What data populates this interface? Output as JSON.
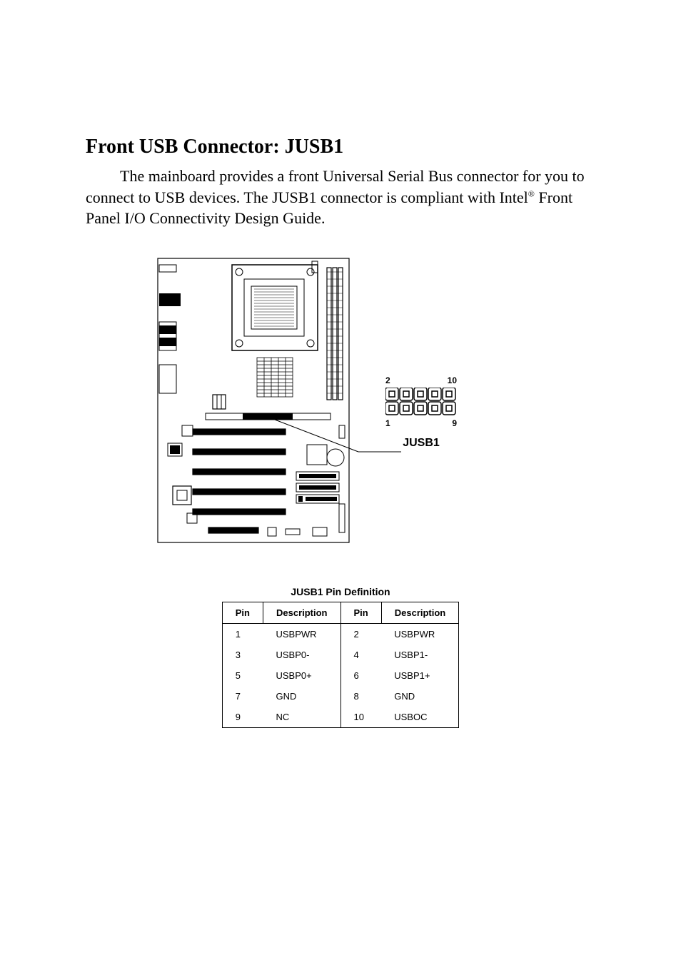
{
  "title": "Front USB Connector: JUSB1",
  "para_plain": "The mainboard provides a front Universal Serial Bus connector for you to connect to USB devices.  The JUSB1 connector is compliant with Intel",
  "para_sup": "®",
  "para_tail": " Front Panel I/O Connectivity Design Guide.",
  "connector": {
    "top_left": "2",
    "top_right": "10",
    "bottom_left": "1",
    "bottom_right": "9",
    "name": "JUSB1"
  },
  "table": {
    "title": "JUSB1 Pin Definition",
    "headers": [
      "Pin",
      "Description",
      "Pin",
      "Description"
    ],
    "rows": [
      [
        "1",
        "USBPWR",
        "2",
        "USBPWR"
      ],
      [
        "3",
        "USBP0-",
        "4",
        "USBP1-"
      ],
      [
        "5",
        "USBP0+",
        "6",
        "USBP1+"
      ],
      [
        "7",
        "GND",
        "8",
        "GND"
      ],
      [
        "9",
        "NC",
        "10",
        "USBOC"
      ]
    ]
  }
}
